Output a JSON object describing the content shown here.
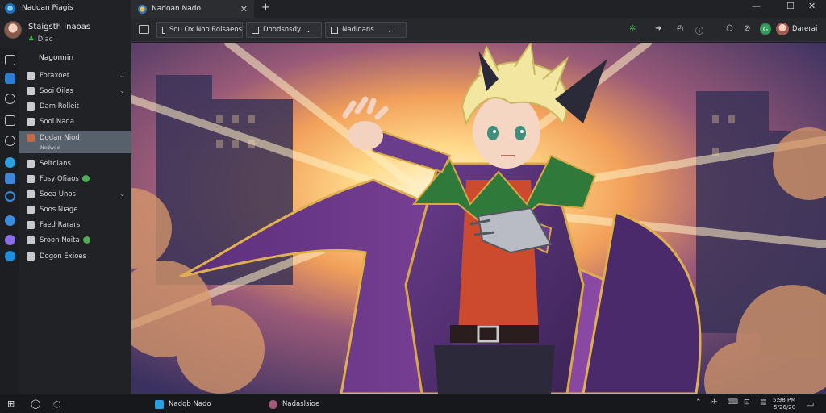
{
  "window": {
    "tab_title": "Nadoan Nado",
    "new_tab_symbol": "+",
    "close_symbol": "✕",
    "minimize_symbol": "—",
    "maximize_symbol": "☐"
  },
  "user": {
    "name": "Nadoan Piagis",
    "profile_name": "Staigsth Inaoas",
    "status": "Dlac",
    "status_icon": "online-dot-icon"
  },
  "sidebar": {
    "section_label": "Nagonnin",
    "items": [
      {
        "label": "Foraxoet",
        "icon": "folder-icon",
        "chevron": "⌄"
      },
      {
        "label": "Sooi Oilas",
        "icon": "folder-icon",
        "chevron": "⌄"
      },
      {
        "label": "Dam Rolleit",
        "icon": "folder-icon"
      },
      {
        "label": "Sooi Nada",
        "icon": "folder-icon"
      },
      {
        "label": "Dodan Niod",
        "icon": "folder-icon",
        "sub": "Nedwee",
        "active": true
      },
      {
        "label": "Seitolans",
        "icon": "folder-icon"
      },
      {
        "label": "Fosy Ofiaos",
        "icon": "folder-icon",
        "badge": true
      },
      {
        "label": "Soea Unos",
        "icon": "folder-icon",
        "chevron": "⌄"
      },
      {
        "label": "Soos Niage",
        "icon": "folder-icon"
      },
      {
        "label": "Faed Rarars",
        "icon": "folder-icon"
      },
      {
        "label": "Sroon Noita",
        "icon": "folder-icon",
        "badge": true
      },
      {
        "label": "Dogon Exioes",
        "icon": "folder-icon"
      }
    ]
  },
  "toolbar": {
    "address_1": "Sou Ox Noo Rolsaeos",
    "address_2": "Doodsnsdy",
    "address_2_dropdown": "⌄",
    "address_3": "Nadidans",
    "address_3_dropdown": "⌄",
    "account_name": "Darerai"
  },
  "taskbar": {
    "app_1": "Nadgb Nado",
    "app_2": "Nadaslsioe",
    "clock_time": "5:98 PM",
    "clock_date": "5/26/20"
  },
  "colors": {
    "accent_green": "#3fb950",
    "active_item": "#58616b",
    "sidebar_bg": "#202226"
  }
}
